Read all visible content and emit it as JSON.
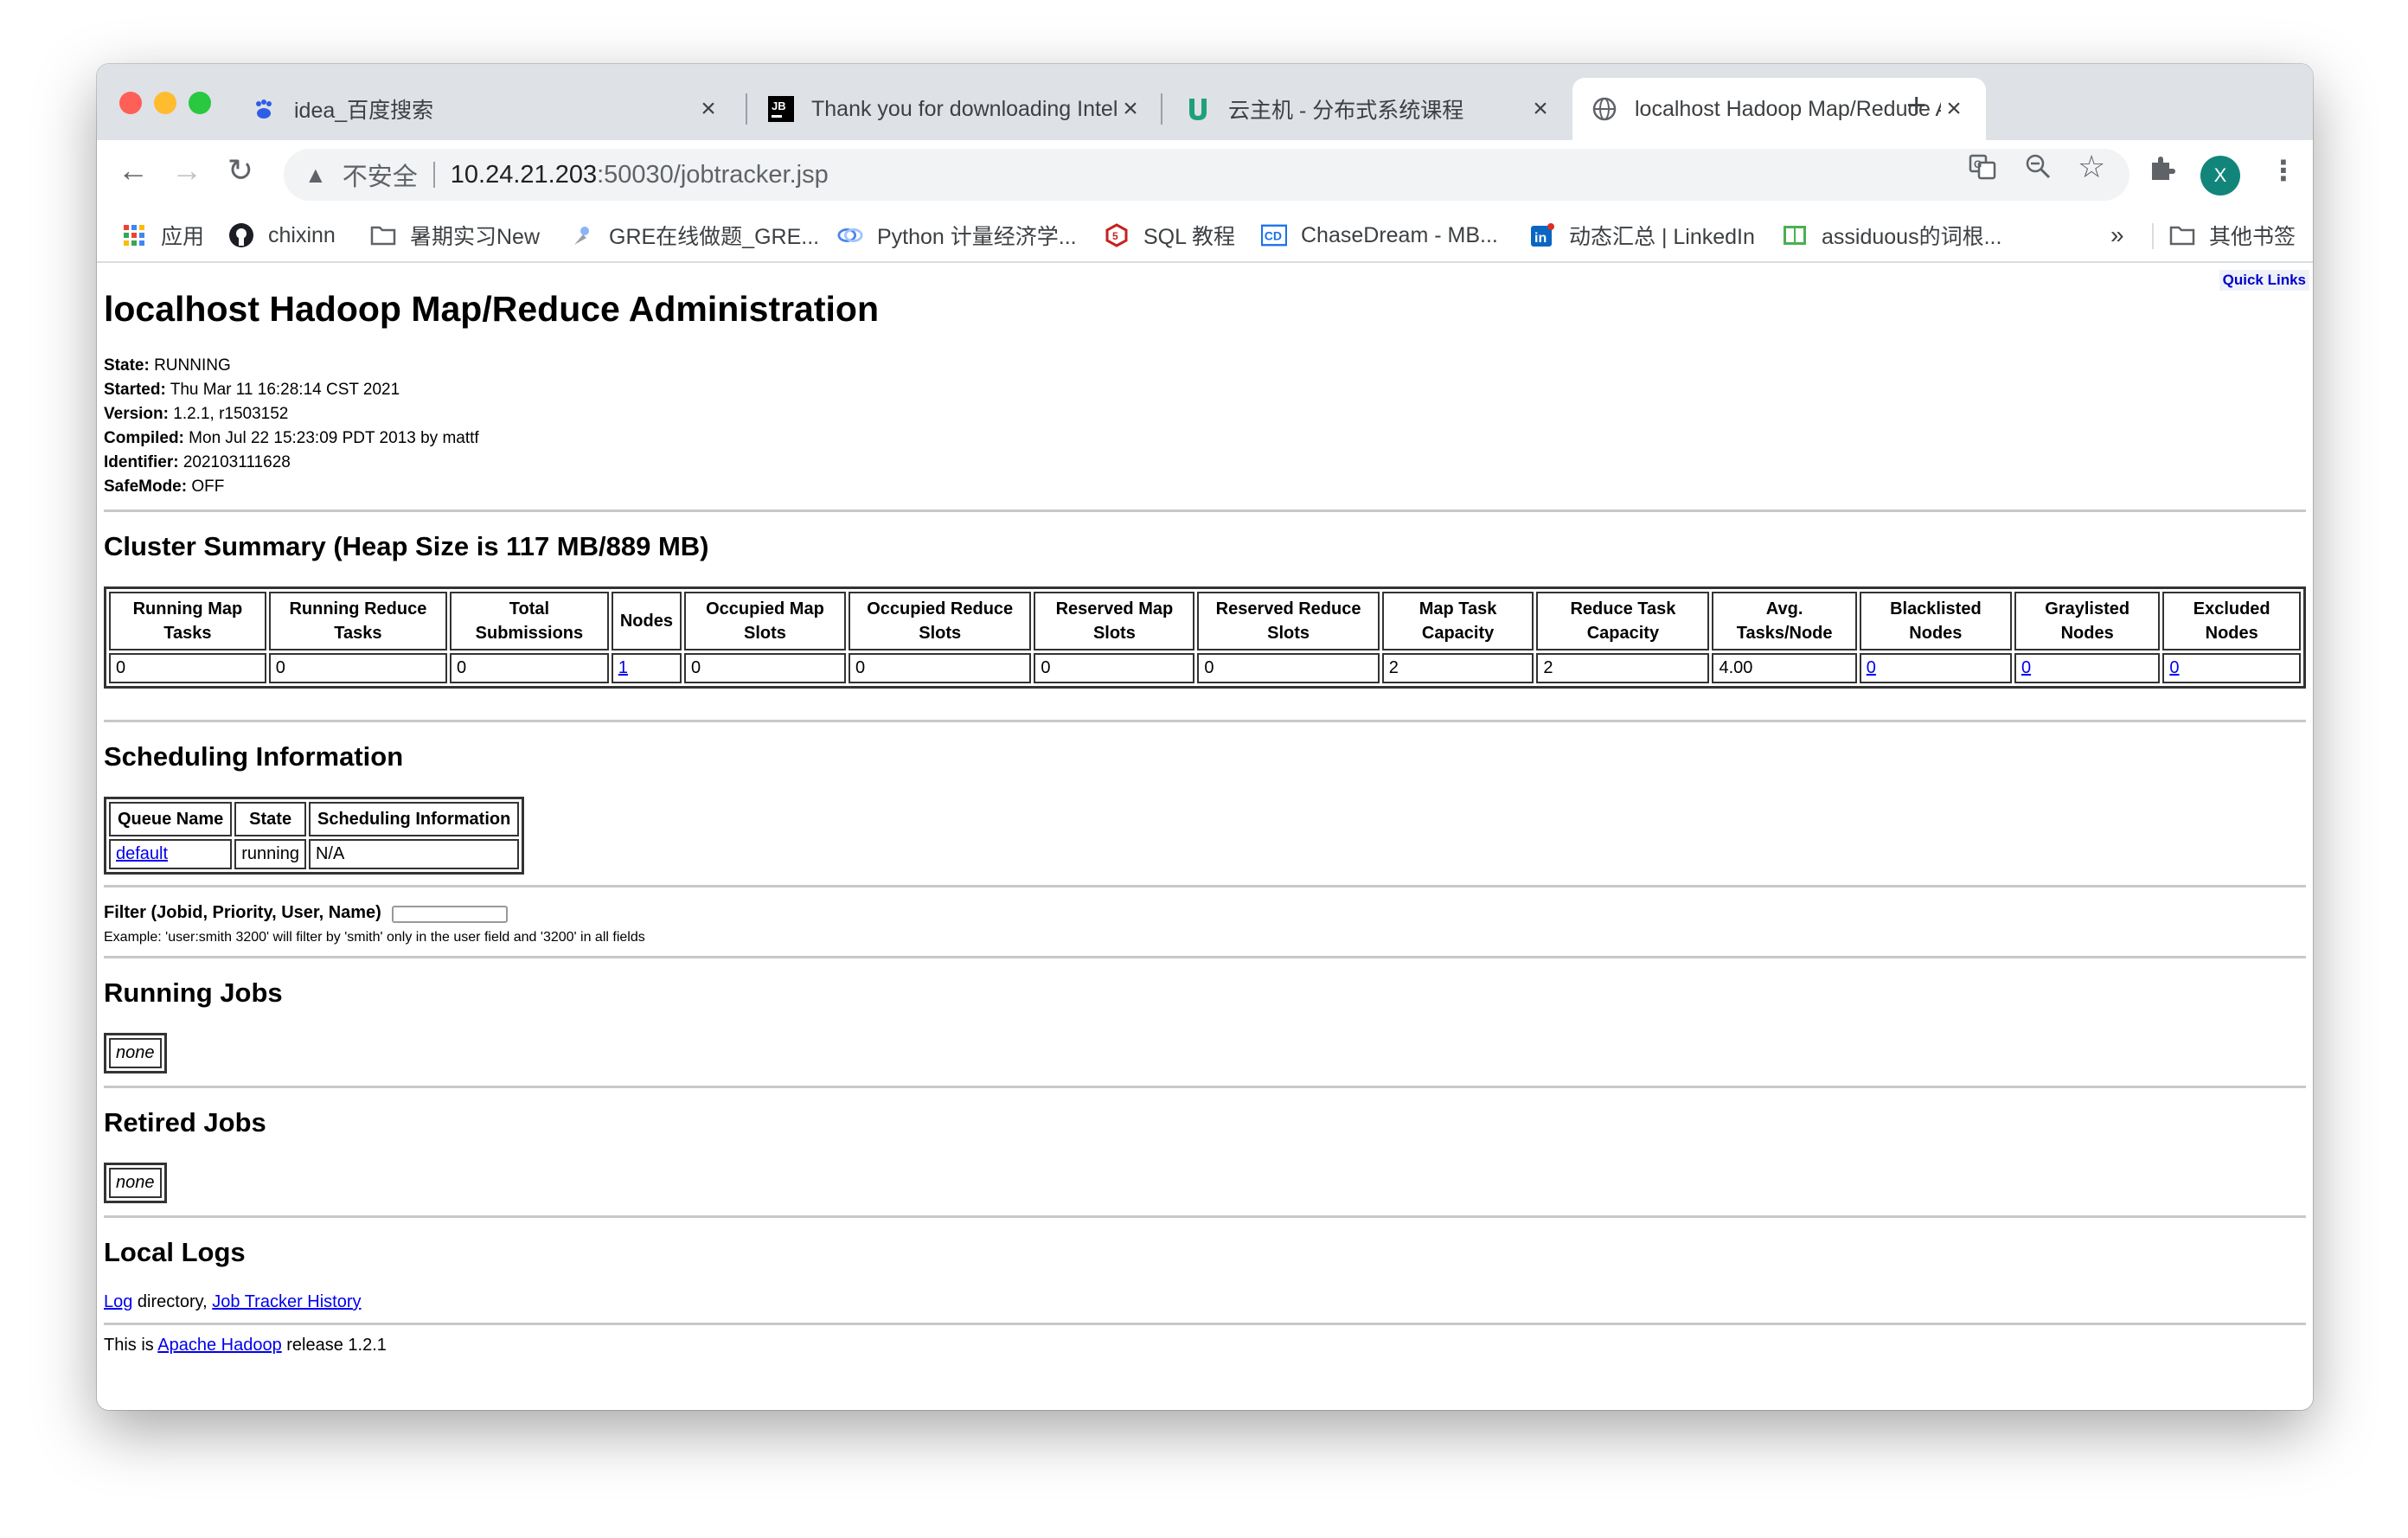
{
  "browser": {
    "tabs": [
      {
        "title": "idea_百度搜索",
        "icon": "baidu-paw-icon",
        "active": false
      },
      {
        "title": "Thank you for downloading IntelliJ IDEA",
        "icon": "jetbrains-icon",
        "active": false
      },
      {
        "title": "云主机 - 分布式系统课程",
        "icon": "u-logo-icon",
        "active": false
      },
      {
        "title": "localhost Hadoop Map/Reduce Administration",
        "icon": "globe-icon",
        "active": true
      }
    ],
    "address": {
      "insecure_label": "不安全",
      "host": "10.24.21.203",
      "path": ":50030/jobtracker.jsp"
    },
    "avatar_letter": "X",
    "bookmarks": [
      {
        "label": "应用",
        "icon": "apps-grid-icon"
      },
      {
        "label": "chixinn",
        "icon": "github-icon"
      },
      {
        "label": "暑期实习New",
        "icon": "folder-icon"
      },
      {
        "label": "GRE在线做题_GRE...",
        "icon": "gre-icon"
      },
      {
        "label": "Python 计量经济学...",
        "icon": "python-site-icon"
      },
      {
        "label": "SQL 教程",
        "icon": "sql-site-icon"
      },
      {
        "label": "ChaseDream - MB...",
        "icon": "chasedream-icon"
      },
      {
        "label": "动态汇总 | LinkedIn",
        "icon": "linkedin-icon"
      },
      {
        "label": "assiduous的词根...",
        "icon": "book-icon"
      }
    ],
    "bookmarks_overflow": "»",
    "other_bookmarks": "其他书签"
  },
  "page": {
    "quick_links": "Quick Links",
    "title": "localhost Hadoop Map/Reduce Administration",
    "meta": [
      {
        "label": "State:",
        "value": " RUNNING"
      },
      {
        "label": "Started:",
        "value": " Thu Mar 11 16:28:14 CST 2021"
      },
      {
        "label": "Version:",
        "value": " 1.2.1, r1503152"
      },
      {
        "label": "Compiled:",
        "value": " Mon Jul 22 15:23:09 PDT 2013 by mattf"
      },
      {
        "label": "Identifier:",
        "value": " 202103111628"
      },
      {
        "label": "SafeMode:",
        "value": " OFF"
      }
    ],
    "cluster_summary": {
      "heading": "Cluster Summary (Heap Size is 117 MB/889 MB)",
      "headers": [
        "Running Map Tasks",
        "Running Reduce Tasks",
        "Total Submissions",
        "Nodes",
        "Occupied Map Slots",
        "Occupied Reduce Slots",
        "Reserved Map Slots",
        "Reserved Reduce Slots",
        "Map Task Capacity",
        "Reduce Task Capacity",
        "Avg. Tasks/Node",
        "Blacklisted Nodes",
        "Graylisted Nodes",
        "Excluded Nodes"
      ],
      "values": [
        "0",
        "0",
        "0",
        "1",
        "0",
        "0",
        "0",
        "0",
        "2",
        "2",
        "4.00",
        "0",
        "0",
        "0"
      ],
      "links": [
        false,
        false,
        false,
        true,
        false,
        false,
        false,
        false,
        false,
        false,
        false,
        true,
        true,
        true
      ]
    },
    "scheduling": {
      "heading": "Scheduling Information",
      "headers": [
        "Queue Name",
        "State",
        "Scheduling Information"
      ],
      "row": [
        "default",
        "running",
        "N/A"
      ]
    },
    "filter": {
      "label": "Filter (Jobid, Priority, User, Name)",
      "example": "Example: 'user:smith 3200' will filter by 'smith' only in the user field and '3200' in all fields"
    },
    "running_jobs": {
      "heading": "Running Jobs",
      "none": "none"
    },
    "retired_jobs": {
      "heading": "Retired Jobs",
      "none": "none"
    },
    "local_logs": {
      "heading": "Local Logs",
      "log_link": "Log",
      "directory_text": " directory, ",
      "history_link": "Job Tracker History"
    },
    "footer": {
      "prefix": "This is ",
      "link": "Apache Hadoop",
      "suffix": " release 1.2.1"
    }
  }
}
